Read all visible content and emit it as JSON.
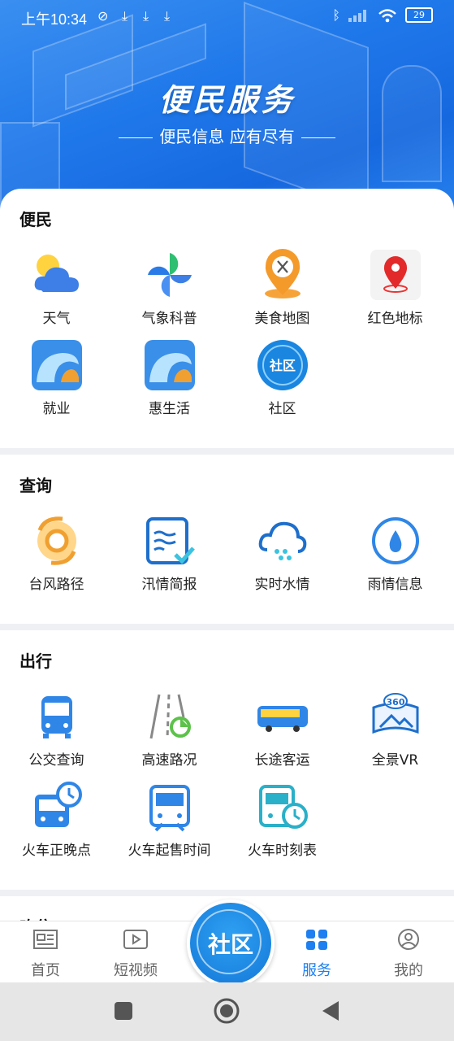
{
  "status": {
    "time": "上午10:34",
    "battery": "29"
  },
  "hero": {
    "title": "便民服务",
    "subtitle": "便民信息 应有尽有"
  },
  "sections": [
    {
      "title": "便民",
      "items": [
        "天气",
        "气象科普",
        "美食地图",
        "红色地标",
        "就业",
        "惠生活",
        "社区"
      ]
    },
    {
      "title": "查询",
      "items": [
        "台风路径",
        "汛情简报",
        "实时水情",
        "雨情信息"
      ]
    },
    {
      "title": "出行",
      "items": [
        "公交查询",
        "高速路况",
        "长途客运",
        "全景VR",
        "火车正晚点",
        "火车起售时间",
        "火车时刻表"
      ]
    },
    {
      "title": "吃住",
      "items": []
    }
  ],
  "icons": {
    "community_badge": "社区",
    "vr_badge": "360"
  },
  "tabbar": {
    "home": "首页",
    "video": "短视频",
    "center": "社区",
    "service": "服务",
    "mine": "我的"
  },
  "colors": {
    "accent": "#1e7ff0",
    "hero": "#1f78ea"
  }
}
